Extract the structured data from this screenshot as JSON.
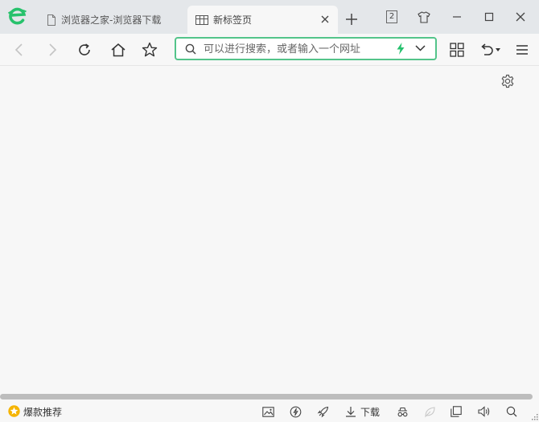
{
  "tabs": [
    {
      "title": "浏览器之家-浏览器下载",
      "active": false
    },
    {
      "title": "新标签页",
      "active": true
    }
  ],
  "window": {
    "tab_count": "2"
  },
  "search": {
    "placeholder": "可以进行搜索，或者输入一个网址"
  },
  "statusbar": {
    "hot_label": "爆款推荐",
    "download_label": "下载"
  },
  "colors": {
    "accent": "#53c48a",
    "logo": "#27c26c",
    "lightning": "#25c06d",
    "hot_badge": "#f5b400"
  }
}
